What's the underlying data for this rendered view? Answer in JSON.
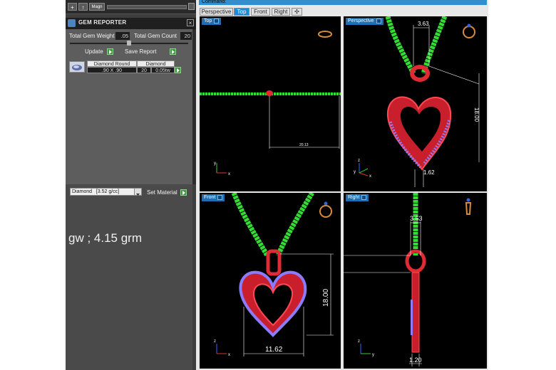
{
  "toolbar": {
    "magn_label": "Magn"
  },
  "gem_reporter": {
    "title": "GEM REPORTER",
    "total_weight_label": "Total Gem Weight",
    "total_weight_value": ".05",
    "total_count_label": "Total Gem Count",
    "total_count_value": "20",
    "update_label": "Update",
    "save_label": "Save Report",
    "row": {
      "shape": "Diamond Round",
      "material": "Diamond",
      "size": ".90 X .90",
      "count": "20",
      "carat": "0.05tw"
    }
  },
  "material": {
    "selected": "Diamond   [3.52 g/cc]",
    "set_label": "Set Material"
  },
  "note": {
    "text": "gw ; 4.15 grm"
  },
  "command": {
    "label": "Command:"
  },
  "tabs": [
    "Perspective",
    "Top",
    "Front",
    "Right"
  ],
  "active_tab": "Top",
  "viewports": {
    "top": {
      "label": "Top",
      "dim": "20.13"
    },
    "perspective": {
      "label": "Perspective",
      "dim_top": "3.63",
      "dim_side": "18.00",
      "dim_bottom": "1.62"
    },
    "front": {
      "label": "Front",
      "dim_h": "18.00",
      "dim_w": "11.62"
    },
    "right": {
      "label": "Right",
      "dim_top": "3.63",
      "dim_bottom": "1.20"
    }
  },
  "axes": {
    "y": "y",
    "x": "x",
    "z": "z"
  },
  "colors": {
    "chain": "#33dd33",
    "metal": "#e02a34",
    "gem": "#8d7bff",
    "dim": "#ffffff",
    "accent": "#1b8ed6"
  }
}
